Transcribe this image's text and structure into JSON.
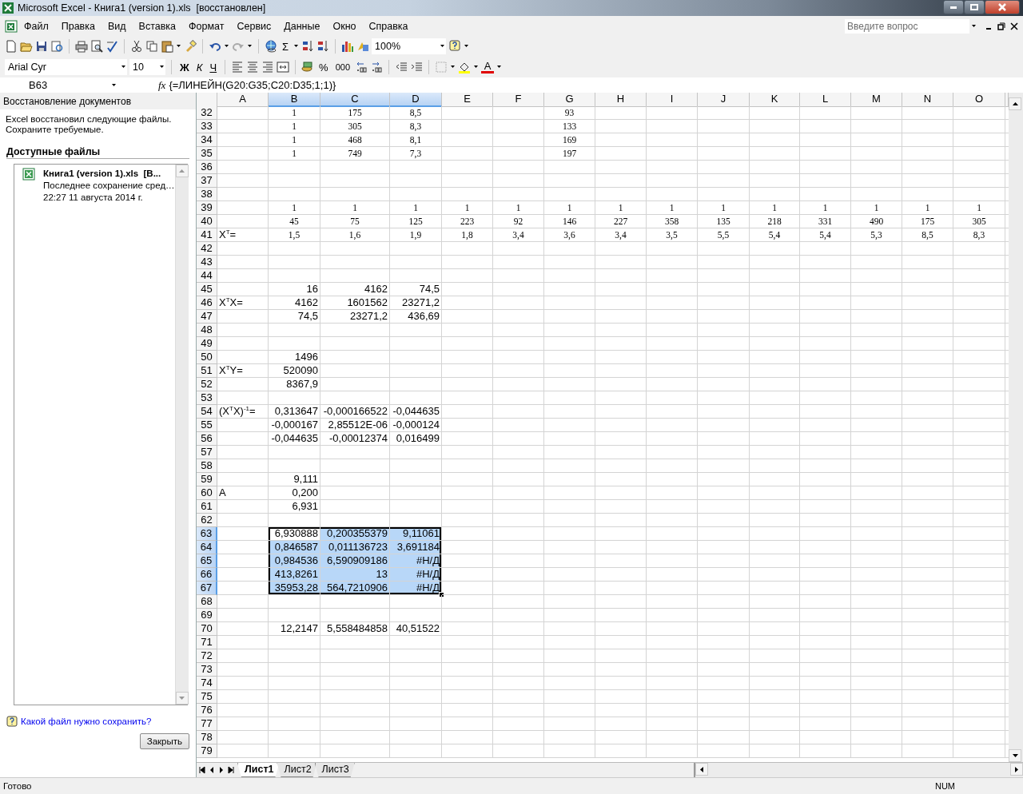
{
  "window": {
    "title": "Microsoft Excel - Книга1 (version 1).xls  [восстановлен]"
  },
  "menu": [
    "Файл",
    "Правка",
    "Вид",
    "Вставка",
    "Формат",
    "Сервис",
    "Данные",
    "Окно",
    "Справка"
  ],
  "help_search": {
    "placeholder": "Введите вопрос"
  },
  "standard_toolbar": {
    "sum": "Σ",
    "zoom": "100%"
  },
  "formatting_toolbar": {
    "font": "Arial Cyr",
    "size": "10",
    "bold": "Ж",
    "italic": "К",
    "underline": "Ч",
    "percent": "%",
    "thousands": "000",
    "font_color": "A"
  },
  "formula_bar": {
    "name_box": "B63",
    "fx": "fx",
    "formula": "{=ЛИНЕЙН(G20:G35;C20:D35;1;1)}"
  },
  "task_pane": {
    "title": "Восстановление документов",
    "message": "Excel восстановил следующие файлы. Сохраните требуемые.",
    "section": "Доступные файлы",
    "files": [
      {
        "name": "Книга1 (version 1).xls  [В...",
        "saved": "Последнее сохранение сред…",
        "time": "22:27 11 августа 2014 г."
      }
    ],
    "help_link": "Какой файл нужно сохранить?",
    "close_button": "Закрыть"
  },
  "columns": [
    {
      "label": "A",
      "selected": false
    },
    {
      "label": "B",
      "selected": true
    },
    {
      "label": "C",
      "selected": true
    },
    {
      "label": "D",
      "selected": true
    },
    {
      "label": "E",
      "selected": false
    },
    {
      "label": "F",
      "selected": false
    },
    {
      "label": "G",
      "selected": false
    },
    {
      "label": "H",
      "selected": false
    },
    {
      "label": "I",
      "selected": false
    },
    {
      "label": "J",
      "selected": false
    },
    {
      "label": "K",
      "selected": false
    },
    {
      "label": "L",
      "selected": false
    },
    {
      "label": "M",
      "selected": false
    },
    {
      "label": "N",
      "selected": false
    },
    {
      "label": "O",
      "selected": false
    }
  ],
  "rows": [
    {
      "header": "32",
      "selected": false,
      "kind": "text",
      "cells": [
        null,
        "1",
        "175",
        "8,5",
        null,
        null,
        "93"
      ]
    },
    {
      "header": "33",
      "selected": false,
      "kind": "text",
      "cells": [
        null,
        "1",
        "305",
        "8,3",
        null,
        null,
        "133"
      ]
    },
    {
      "header": "34",
      "selected": false,
      "kind": "text",
      "cells": [
        null,
        "1",
        "468",
        "8,1",
        null,
        null,
        "169"
      ]
    },
    {
      "header": "35",
      "selected": false,
      "kind": "text",
      "cells": [
        null,
        "1",
        "749",
        "7,3",
        null,
        null,
        "197"
      ]
    },
    {
      "header": "36",
      "selected": false
    },
    {
      "header": "37",
      "selected": false
    },
    {
      "header": "38",
      "selected": false
    },
    {
      "header": "39",
      "selected": false,
      "kind": "text",
      "cells": [
        null,
        "1",
        "1",
        "1",
        "1",
        "1",
        "1",
        "1",
        "1",
        "1",
        "1",
        "1",
        "1",
        "1",
        "1"
      ]
    },
    {
      "header": "40",
      "selected": false,
      "kind": "text",
      "cells": [
        null,
        "45",
        "75",
        "125",
        "223",
        "92",
        "146",
        "227",
        "358",
        "135",
        "218",
        "331",
        "490",
        "175",
        "305"
      ]
    },
    {
      "header": "41",
      "selected": false,
      "kind": "text",
      "cells": [
        "X$^{T}$=",
        "1,5",
        "1,6",
        "1,9",
        "1,8",
        "3,4",
        "3,6",
        "3,4",
        "3,5",
        "5,5",
        "5,4",
        "5,4",
        "5,3",
        "8,5",
        "8,3"
      ]
    },
    {
      "header": "42",
      "selected": false
    },
    {
      "header": "43",
      "selected": false
    },
    {
      "header": "44",
      "selected": false
    },
    {
      "header": "45",
      "selected": false,
      "kind": "number",
      "cells": [
        null,
        "16",
        "4162",
        "74,5"
      ]
    },
    {
      "header": "46",
      "selected": false,
      "kind": "number",
      "cells": [
        "X$^{T}$X=",
        "4162",
        "1601562",
        "23271,2"
      ]
    },
    {
      "header": "47",
      "selected": false,
      "kind": "number",
      "cells": [
        null,
        "74,5",
        "23271,2",
        "436,69"
      ]
    },
    {
      "header": "48",
      "selected": false
    },
    {
      "header": "49",
      "selected": false
    },
    {
      "header": "50",
      "selected": false,
      "kind": "number",
      "cells": [
        null,
        "1496"
      ]
    },
    {
      "header": "51",
      "selected": false,
      "kind": "number",
      "cells": [
        "X$^{T}$Y=",
        "520090"
      ]
    },
    {
      "header": "52",
      "selected": false,
      "kind": "number",
      "cells": [
        null,
        "8367,9"
      ]
    },
    {
      "header": "53",
      "selected": false
    },
    {
      "header": "54",
      "selected": false,
      "kind": "number",
      "cells": [
        "(X$^{T}$X)$^{-1}$=",
        "0,313647",
        "-0,000166522",
        "-0,044635"
      ]
    },
    {
      "header": "55",
      "selected": false,
      "kind": "number",
      "cells": [
        null,
        "-0,000167",
        "2,85512E-06",
        "-0,000124"
      ]
    },
    {
      "header": "56",
      "selected": false,
      "kind": "number",
      "cells": [
        null,
        "-0,044635",
        "-0,00012374",
        "0,016499"
      ]
    },
    {
      "header": "57",
      "selected": false
    },
    {
      "header": "58",
      "selected": false
    },
    {
      "header": "59",
      "selected": false,
      "kind": "number",
      "cells": [
        null,
        "9,111"
      ]
    },
    {
      "header": "60",
      "selected": false,
      "kind": "number",
      "cells": [
        "A",
        "0,200"
      ]
    },
    {
      "header": "61",
      "selected": false,
      "kind": "number",
      "cells": [
        null,
        "6,931"
      ]
    },
    {
      "header": "62",
      "selected": false
    },
    {
      "header": "63",
      "selected": true,
      "kind": "number",
      "cells": [
        null,
        "6,930888",
        "0,200355379",
        "9,11061"
      ]
    },
    {
      "header": "64",
      "selected": true,
      "kind": "number",
      "cells": [
        null,
        "0,846587",
        "0,011136723",
        "3,691184"
      ]
    },
    {
      "header": "65",
      "selected": true,
      "kind": "number",
      "cells": [
        null,
        "0,984536",
        "6,590909186",
        "#Н/Д"
      ]
    },
    {
      "header": "66",
      "selected": true,
      "kind": "number",
      "cells": [
        null,
        "413,8261",
        "13",
        "#Н/Д"
      ]
    },
    {
      "header": "67",
      "selected": true,
      "kind": "number",
      "cells": [
        null,
        "35953,28",
        "564,7210906",
        "#Н/Д"
      ]
    },
    {
      "header": "68",
      "selected": false
    },
    {
      "header": "69",
      "selected": false
    },
    {
      "header": "70",
      "selected": false,
      "kind": "number",
      "cells": [
        null,
        "12,2147",
        "5,558484858",
        "40,51522"
      ]
    },
    {
      "header": "71",
      "selected": false
    },
    {
      "header": "72",
      "selected": false
    },
    {
      "header": "73",
      "selected": false
    },
    {
      "header": "74",
      "selected": false
    },
    {
      "header": "75",
      "selected": false
    },
    {
      "header": "76",
      "selected": false
    },
    {
      "header": "77",
      "selected": false
    },
    {
      "header": "78",
      "selected": false
    },
    {
      "header": "79",
      "selected": false
    }
  ],
  "sheet_tabs": [
    {
      "label": "Лист1",
      "selected": true
    },
    {
      "label": "Лист2",
      "selected": false
    },
    {
      "label": "Лист3",
      "selected": false
    }
  ],
  "status_bar": {
    "status": "Готово",
    "num": "NUM"
  }
}
